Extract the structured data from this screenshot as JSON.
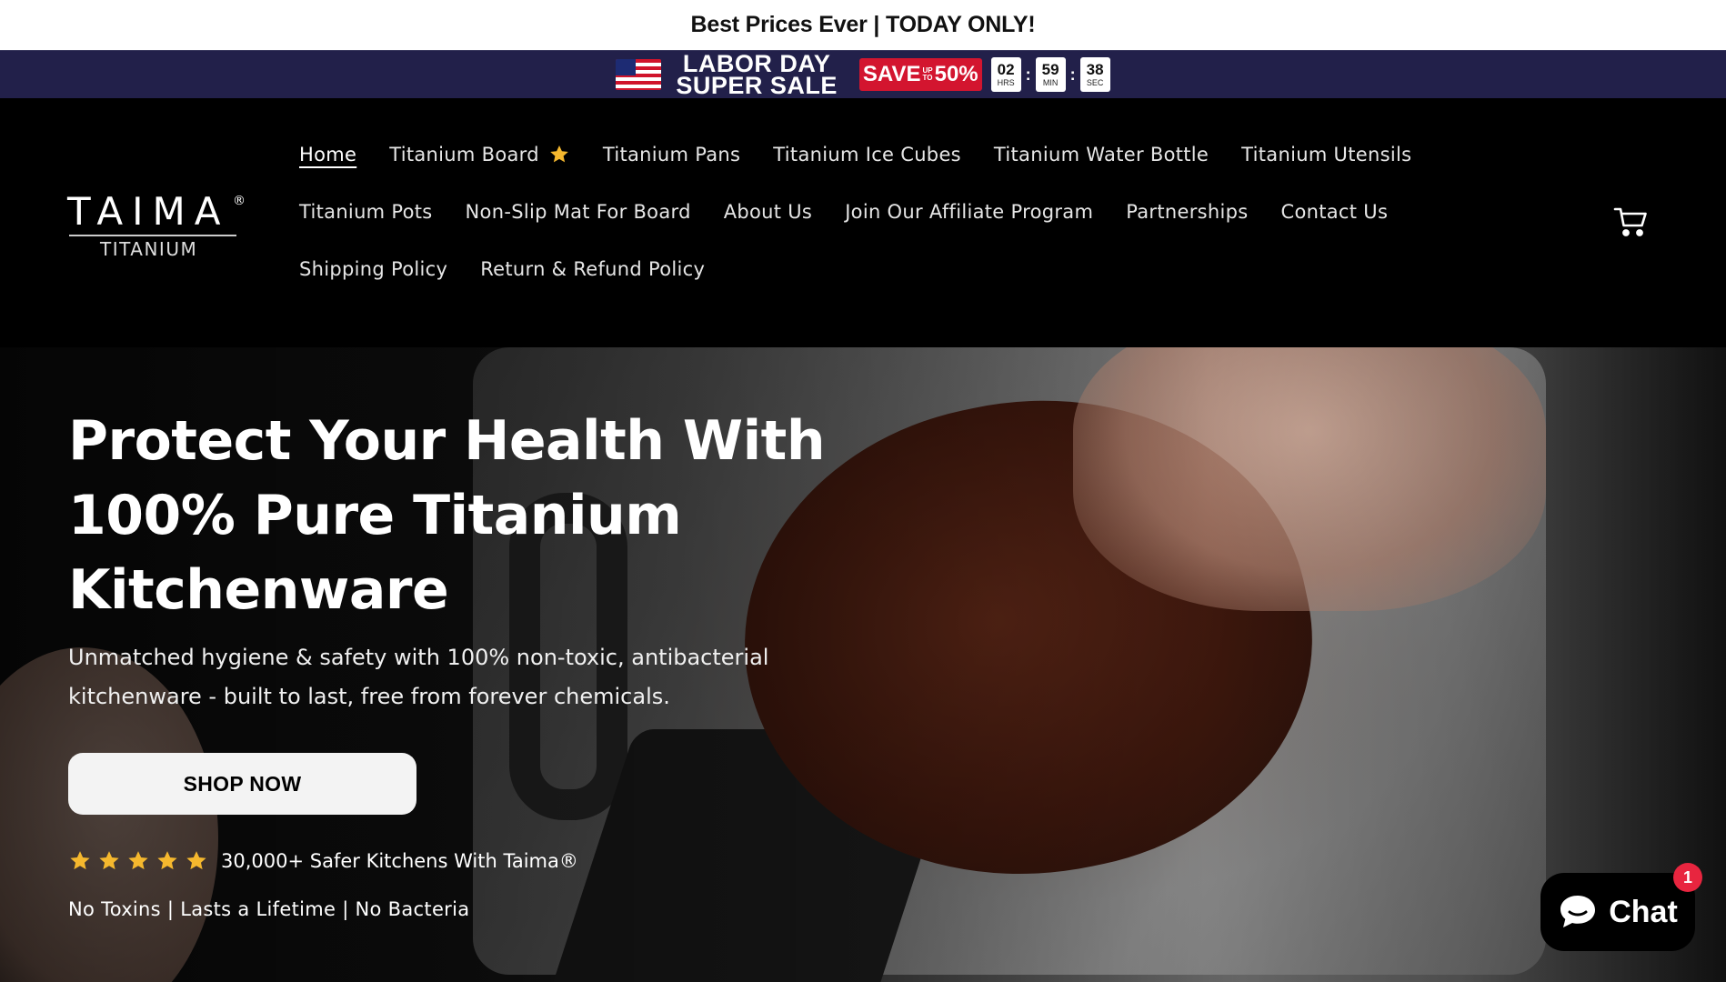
{
  "announcement": {
    "text": "Best Prices Ever | TODAY ONLY!"
  },
  "sale_banner": {
    "title_line1": "LABOR DAY",
    "title_line2": "SUPER SALE",
    "save_label": "SAVE",
    "upto_line1": "UP",
    "upto_line2": "TO",
    "percent": "50%",
    "timer": {
      "hours": "02",
      "hours_label": "HRS",
      "minutes": "59",
      "minutes_label": "MIN",
      "seconds": "38",
      "seconds_label": "SEC"
    },
    "colors": {
      "bar_bg": "#22204a",
      "save_bg": "#d3152f"
    }
  },
  "logo": {
    "name": "TAIMA",
    "mark": "®",
    "sub": "TITANIUM"
  },
  "nav": {
    "rows": [
      [
        {
          "label": "Home",
          "active": true
        },
        {
          "label": "Titanium Board",
          "icon": "star-icon"
        },
        {
          "label": "Titanium Pans"
        },
        {
          "label": "Titanium Ice Cubes"
        },
        {
          "label": "Titanium Water Bottle"
        },
        {
          "label": "Titanium Utensils"
        }
      ],
      [
        {
          "label": "Titanium Pots"
        },
        {
          "label": "Non-Slip Mat For Board"
        },
        {
          "label": "About Us"
        },
        {
          "label": "Join Our Affiliate Program"
        },
        {
          "label": "Partnerships"
        },
        {
          "label": "Contact Us"
        }
      ],
      [
        {
          "label": "Shipping Policy"
        },
        {
          "label": "Return & Refund Policy"
        }
      ]
    ],
    "cart_icon": "cart-icon"
  },
  "hero": {
    "title_line1": "Protect Your Health With",
    "title_line2": "100% Pure Titanium",
    "title_line3": "Kitchenware",
    "subtitle_line1": "Unmatched hygiene & safety with 100% non-toxic, antibacterial",
    "subtitle_line2": "kitchenware - built to last, free from forever chemicals.",
    "cta": "SHOP NOW",
    "rating_stars": 5,
    "rating_text": "30,000+ Safer Kitchens With Taima®",
    "features": "No Toxins | Lasts a Lifetime | No Bacteria",
    "star_color": "#f5b82e"
  },
  "chat": {
    "label": "Chat",
    "badge": "1",
    "icon": "chat-bubble-icon"
  }
}
